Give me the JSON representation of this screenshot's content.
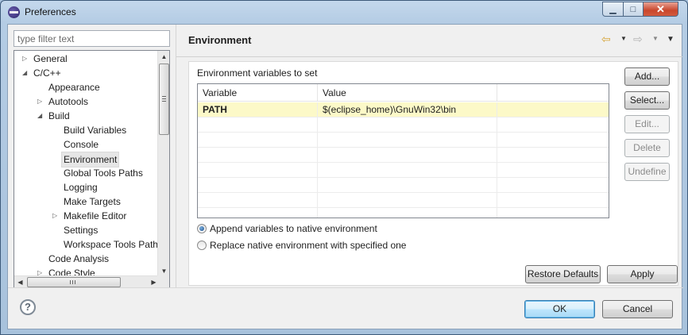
{
  "window": {
    "title": "Preferences",
    "controls": {
      "minimize": "▁",
      "maximize": "□",
      "close": "✕"
    }
  },
  "filter": {
    "placeholder": "type filter text",
    "value": ""
  },
  "tree": {
    "items": [
      {
        "label": "General",
        "twisty": "collapsed"
      },
      {
        "label": "C/C++",
        "twisty": "expanded"
      },
      {
        "label": "Appearance",
        "twisty": "none"
      },
      {
        "label": "Autotools",
        "twisty": "collapsed"
      },
      {
        "label": "Build",
        "twisty": "expanded"
      },
      {
        "label": "Build Variables",
        "twisty": "none"
      },
      {
        "label": "Console",
        "twisty": "none"
      },
      {
        "label": "Environment",
        "twisty": "none",
        "selected": true
      },
      {
        "label": "Global Tools Paths",
        "twisty": "none"
      },
      {
        "label": "Logging",
        "twisty": "none"
      },
      {
        "label": "Make Targets",
        "twisty": "none"
      },
      {
        "label": "Makefile Editor",
        "twisty": "collapsed"
      },
      {
        "label": "Settings",
        "twisty": "none"
      },
      {
        "label": "Workspace Tools Path",
        "twisty": "none"
      },
      {
        "label": "Code Analysis",
        "twisty": "none"
      },
      {
        "label": "Code Style",
        "twisty": "collapsed"
      }
    ]
  },
  "page": {
    "title": "Environment",
    "nav": {
      "back_icon": "back-arrow",
      "forward_icon": "forward-arrow",
      "menu_icon": "view-menu"
    }
  },
  "env": {
    "group_label": "Environment variables to set",
    "columns": [
      "Variable",
      "Value"
    ],
    "rows": [
      {
        "variable": "PATH",
        "value": "$(eclipse_home)\\GnuWin32\\bin"
      }
    ],
    "buttons": {
      "add": "Add...",
      "select": "Select...",
      "edit": "Edit...",
      "delete": "Delete",
      "undefine": "Undefine"
    },
    "options": {
      "append": "Append variables to native environment",
      "replace": "Replace native environment with specified one",
      "selected": "append"
    }
  },
  "actions": {
    "restore_defaults": "Restore Defaults",
    "apply": "Apply",
    "ok": "OK",
    "cancel": "Cancel",
    "help": "?"
  },
  "colors": {
    "selected_row": "#fcf9c8",
    "window_frame": "#b4cce4",
    "default_button": "#bee6fd"
  }
}
